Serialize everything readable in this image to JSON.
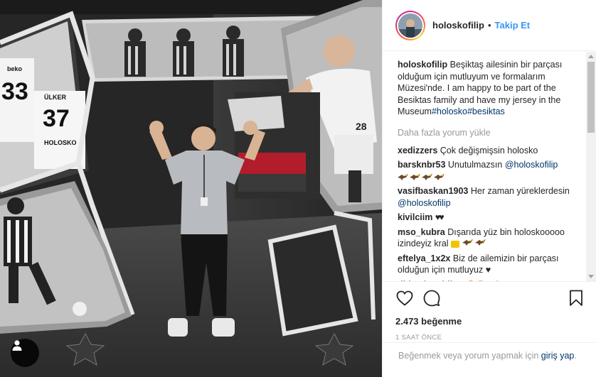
{
  "header": {
    "username": "holoskofilip",
    "separator": "•",
    "follow_label": "Takip Et"
  },
  "caption": {
    "username": "holoskofilip",
    "text": "Beşiktaş ailesinin bir parçası olduğum için mutluyum ve formalarım Müzesi'nde. I am happy to be part of the Besiktas family and have my jersey in the Museum",
    "hashtags": "#holosko#besiktas"
  },
  "load_more_label": "Daha fazla yorum yükle",
  "comments": [
    {
      "username": "xedizzers",
      "text": "Çok değişmişsin holosko",
      "mention": "",
      "after": ""
    },
    {
      "username": "barsknbr53",
      "text": "Unutulmazsın",
      "mention": "@holoskofilip",
      "after": ""
    },
    {
      "username": "vasifbaskan1903",
      "text": "Her zaman yüreklerdesin",
      "mention": "@holoskofilip",
      "after": ""
    },
    {
      "username": "kivilciim",
      "text": "♥♥",
      "mention": "",
      "after": ""
    },
    {
      "username": "mso_kubra",
      "text": "Dışarıda yüz bin holoskooooo izindeyiz kral",
      "mention": "",
      "after": ""
    },
    {
      "username": "eftelya_1x2x",
      "text": "Biz de ailemizin bir parçası olduğun için mutluyuz",
      "mention": "",
      "after": "♥"
    },
    {
      "username": "didemkarabiber",
      "text": "",
      "mention": "",
      "after": ""
    }
  ],
  "icons": {
    "like": "heart-outline-icon",
    "comment": "speech-bubble-icon",
    "save": "bookmark-icon",
    "tag": "user-tag-icon"
  },
  "likes_label": "2.473 beğenme",
  "timestamp": "1 SAAT ÖNCE",
  "login_prompt": {
    "text": "Beğenmek veya yorum yapmak için",
    "link": "giriş yap",
    "end": "."
  },
  "colors": {
    "link_blue": "#3897f0",
    "link_dark": "#003569",
    "muted": "#999999",
    "text": "#262626",
    "border": "#efefef"
  }
}
